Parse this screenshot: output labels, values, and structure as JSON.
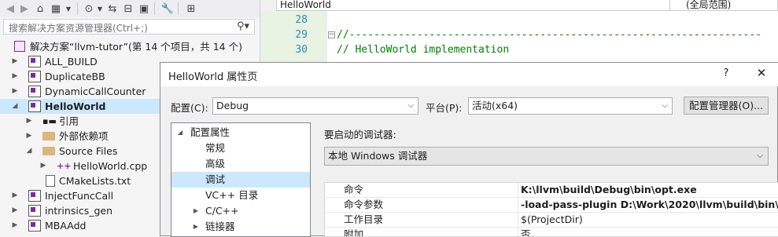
{
  "solution_explorer": {
    "search_placeholder": "搜索解决方案资源管理器(Ctrl+;)",
    "solution_label": "解决方案“llvm-tutor”(第 14 个项目，共 14 个)",
    "items": [
      {
        "label": "ALL_BUILD"
      },
      {
        "label": "DuplicateBB"
      },
      {
        "label": "DynamicCallCounter"
      },
      {
        "label": "HelloWorld"
      },
      {
        "label": "引用"
      },
      {
        "label": "外部依赖项"
      },
      {
        "label": "Source Files"
      },
      {
        "label": "HelloWorld.cpp"
      },
      {
        "label": "CMakeLists.txt"
      },
      {
        "label": "InjectFuncCall"
      },
      {
        "label": "intrinsics_gen"
      },
      {
        "label": "MBAAdd"
      }
    ]
  },
  "editor": {
    "file_dropdown": "HelloWorld",
    "scope_dropdown": "(全局范围)",
    "lines": [
      {
        "num": "28",
        "text": ""
      },
      {
        "num": "29",
        "text": "//-------------------------------------------------------------------"
      },
      {
        "num": "30",
        "text": "// HelloWorld implementation"
      }
    ]
  },
  "dialog": {
    "title": "HelloWorld 属性页",
    "help": "?",
    "close": "✕",
    "config_label": "配置(C):",
    "config_value": "Debug",
    "platform_label": "平台(P):",
    "platform_value": "活动(x64)",
    "config_manager_button": "配置管理器(O)...",
    "tree": [
      {
        "label": "配置属性"
      },
      {
        "label": "常规"
      },
      {
        "label": "高级"
      },
      {
        "label": "调试"
      },
      {
        "label": "VC++ 目录"
      },
      {
        "label": "C/C++"
      },
      {
        "label": "链接器"
      }
    ],
    "debugger_label": "要启动的调试器:",
    "debugger_value": "本地 Windows 调试器",
    "props": [
      {
        "key": "命令",
        "value": "K:\\llvm\\build\\Debug\\bin\\opt.exe"
      },
      {
        "key": "命令参数",
        "value": "-load-pass-plugin D:\\Work\\2020\\llvm\\build\\bin\\De"
      },
      {
        "key": "工作目录",
        "value": "$(ProjectDir)"
      },
      {
        "key": "附加",
        "value": "否"
      }
    ]
  }
}
